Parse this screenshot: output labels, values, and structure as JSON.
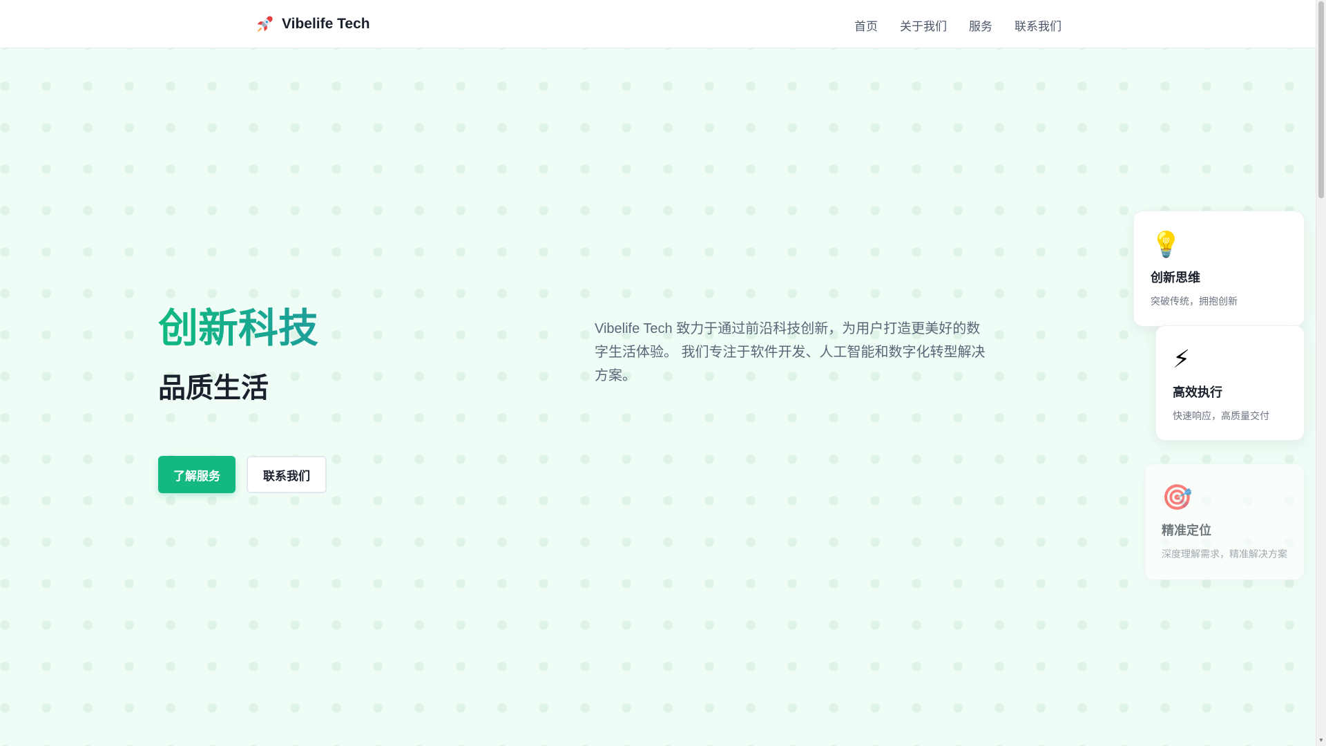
{
  "header": {
    "logo_text": "Vibelife Tech",
    "logo_icon": "rocket-icon",
    "nav": [
      {
        "label": "首页"
      },
      {
        "label": "关于我们"
      },
      {
        "label": "服务"
      },
      {
        "label": "联系我们"
      }
    ]
  },
  "hero": {
    "title": "创新科技",
    "subtitle": "品质生活",
    "primary_button": "了解服务",
    "secondary_button": "联系我们",
    "description": "Vibelife Tech 致力于通过前沿科技创新，为用户打造更美好的数字生活体验。 我们专注于软件开发、人工智能和数字化转型解决方案。"
  },
  "features": [
    {
      "icon": "lightbulb-icon",
      "glyph": "💡",
      "title": "创新思维",
      "text": "突破传统，拥抱创新"
    },
    {
      "icon": "lightning-icon",
      "glyph": "⚡",
      "title": "高效执行",
      "text": "快速响应，高质量交付"
    },
    {
      "icon": "target-icon",
      "glyph": "🎯",
      "title": "精准定位",
      "text": "深度理解需求，精准解决方案"
    }
  ],
  "colors": {
    "accent": "#13b981",
    "background": "#f0fdf6",
    "title_gradient_end": "#1f9d9a"
  }
}
